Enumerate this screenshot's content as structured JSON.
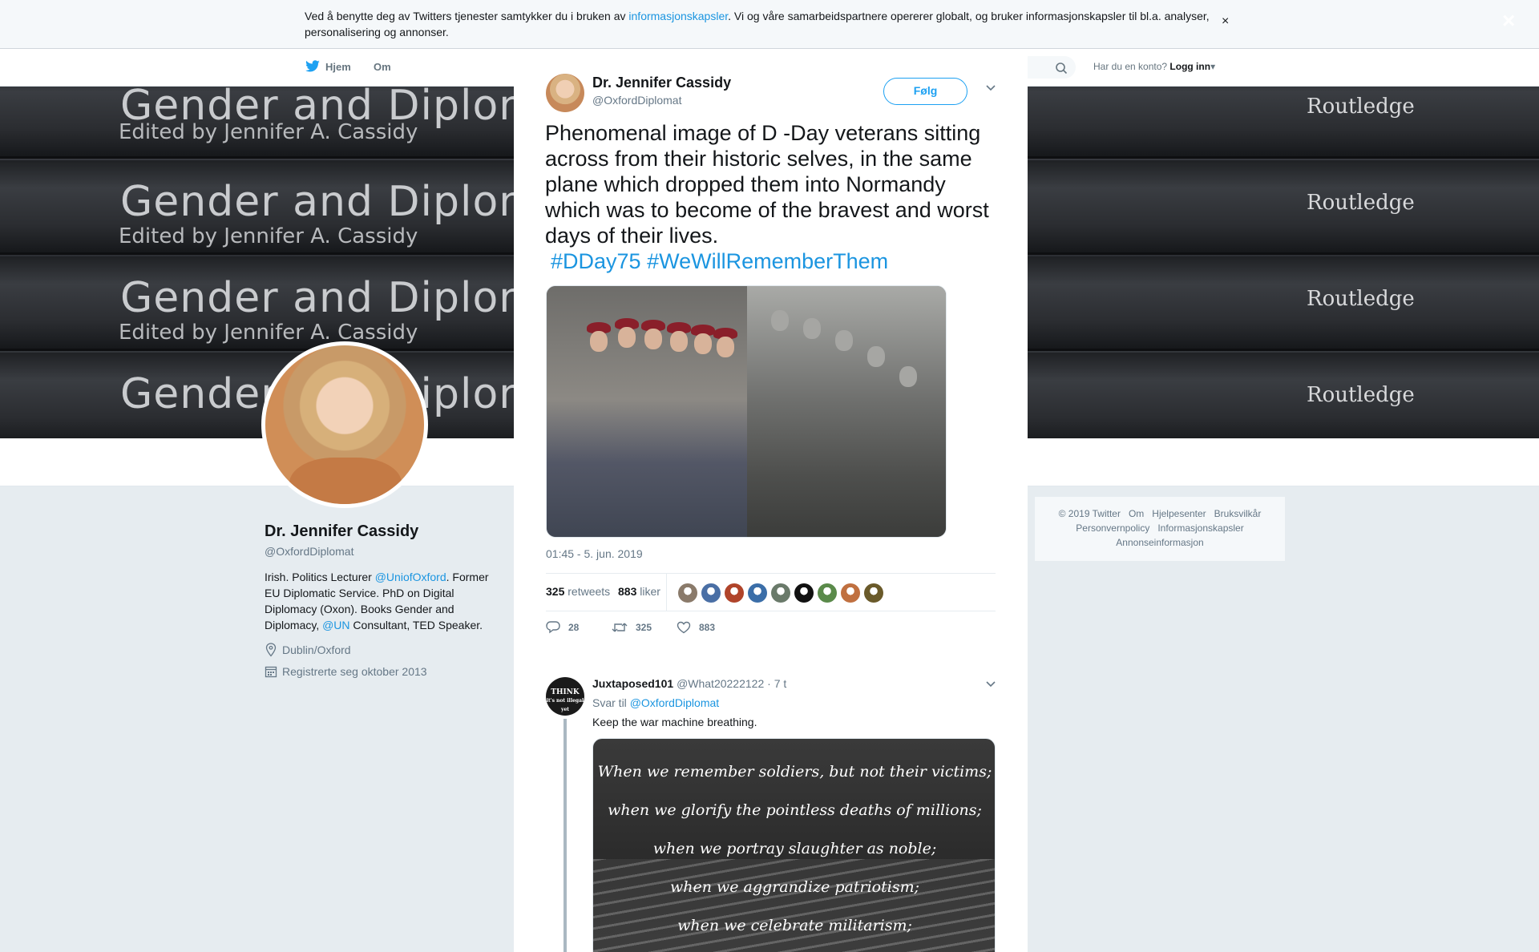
{
  "cookie": {
    "text_before": "Ved å benytte deg av Twitters tjenester samtykker du i bruken av ",
    "link": "informasjonskapsler",
    "text_after": ". Vi og våre samarbeidspartnere opererer globalt, og bruker informasjonskapsler til bl.a. analyser, personalisering og annonser.",
    "close": "×"
  },
  "nav": {
    "home": "Hjem",
    "about": "Om",
    "account_prompt": "Har du en konto?",
    "login": "Logg inn"
  },
  "banner": {
    "books": [
      {
        "title": "Gender and Diplomacy",
        "subtitle": "Edited by Jennifer A. Cassidy",
        "publisher": "Routledge"
      },
      {
        "title": "Gender and Diplomacy",
        "subtitle": "Edited by Jennifer A. Cassidy",
        "publisher": "Routledge"
      },
      {
        "title": "Gender and Diplomacy",
        "subtitle": "Edited by Jennifer A. Cassidy",
        "publisher": "Routledge"
      },
      {
        "title": "Gender and Diplomacy",
        "subtitle": "",
        "publisher": "Routledge"
      }
    ]
  },
  "profile": {
    "name": "Dr. Jennifer Cassidy",
    "handle": "@OxfordDiplomat",
    "bio_1": "Irish. Politics Lecturer ",
    "bio_link_1": "@UniofOxford",
    "bio_2": ". Former EU Diplomatic Service. PhD on Digital Diplomacy (Oxon). Books Gender and Diplomacy, ",
    "bio_link_2": "@UN",
    "bio_3": " Consultant, TED Speaker.",
    "location": "Dublin/Oxford",
    "joined": "Registrerte seg oktober 2013"
  },
  "footer": {
    "links": [
      "© 2019 Twitter",
      "Om",
      "Hjelpesenter",
      "Bruksvilkår",
      "Personvernpolicy",
      "Informasjonskapsler",
      "Annonseinformasjon"
    ]
  },
  "overlay_close": "×",
  "tweet": {
    "author_name": "Dr. Jennifer Cassidy",
    "author_handle": "@OxfordDiplomat",
    "follow": "Følg",
    "text": "Phenomenal image of D -Day veterans sitting across from their historic selves, in the same plane which dropped them into Normandy which was to become of the bravest and worst days of their lives.",
    "hashtags": "#DDay75 #WeWillRememberThem",
    "timestamp": "01:45 - 5. jun. 2019",
    "retweets_count": "325",
    "retweets_label": "retweets",
    "likes_count": "883",
    "likes_label": "liker",
    "reply_count": "28",
    "retweet_action_count": "325",
    "like_action_count": "883",
    "facepile_colors": [
      "#8a7a6a",
      "#4a6fa5",
      "#b0442a",
      "#3b6ea8",
      "#6a7a6a",
      "#111111",
      "#5a8a4a",
      "#c07040",
      "#6a5a2a"
    ]
  },
  "reply": {
    "avatar_text": "THINK it's not illegal yet",
    "name": "Juxtaposed101",
    "handle": "@What20222122",
    "time": "· 7 t",
    "reply_to_label": "Svar til ",
    "reply_to_link": "@OxfordDiplomat",
    "text": "Keep the war machine breathing.",
    "image_lines": [
      "When we remember soldiers, but not their victims;",
      "when we glorify the pointless deaths of millions;",
      "when we portray slaughter as noble;",
      "when we aggrandize patriotism;",
      "when we celebrate militarism;"
    ]
  }
}
